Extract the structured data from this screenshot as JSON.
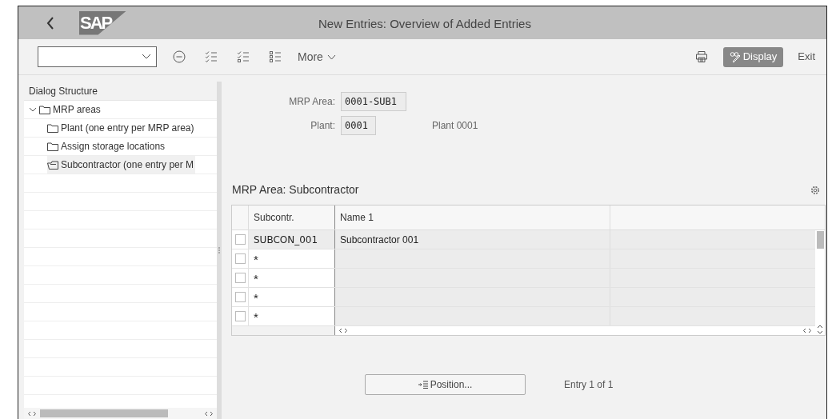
{
  "window": {
    "title": "New Entries: Overview of Added Entries",
    "logo": "SAP"
  },
  "toolbar": {
    "more": "More",
    "display": "Display",
    "exit": "Exit"
  },
  "dialog_structure": {
    "title": "Dialog Structure",
    "items": [
      {
        "label": "MRP areas",
        "expanded": true,
        "selected": false,
        "children": [
          {
            "label": "Plant (one entry per MRP area)",
            "selected": false
          },
          {
            "label": "Assign storage locations",
            "selected": false
          },
          {
            "label": "Subcontractor (one entry per M",
            "selected": true
          }
        ]
      }
    ]
  },
  "form": {
    "fields": [
      {
        "label": "MRP Area:",
        "value": "0001-SUB1"
      },
      {
        "label": "Plant:",
        "value": "0001",
        "description": "Plant 0001"
      }
    ]
  },
  "table": {
    "title": "MRP Area: Subcontractor",
    "columns": [
      "Subcontr.",
      "Name 1"
    ],
    "rows": [
      {
        "selected": false,
        "editable": false,
        "cells": [
          "SUBCON_001",
          "Subcontractor 001"
        ]
      },
      {
        "selected": false,
        "editable": true,
        "cells": [
          "*"
        ]
      },
      {
        "selected": false,
        "editable": true,
        "cells": [
          "*"
        ]
      },
      {
        "selected": false,
        "editable": true,
        "cells": [
          "*"
        ]
      },
      {
        "selected": false,
        "editable": true,
        "cells": [
          "*"
        ]
      }
    ]
  },
  "footer": {
    "position_button": "Position...",
    "entry": "Entry 1 of 1"
  }
}
